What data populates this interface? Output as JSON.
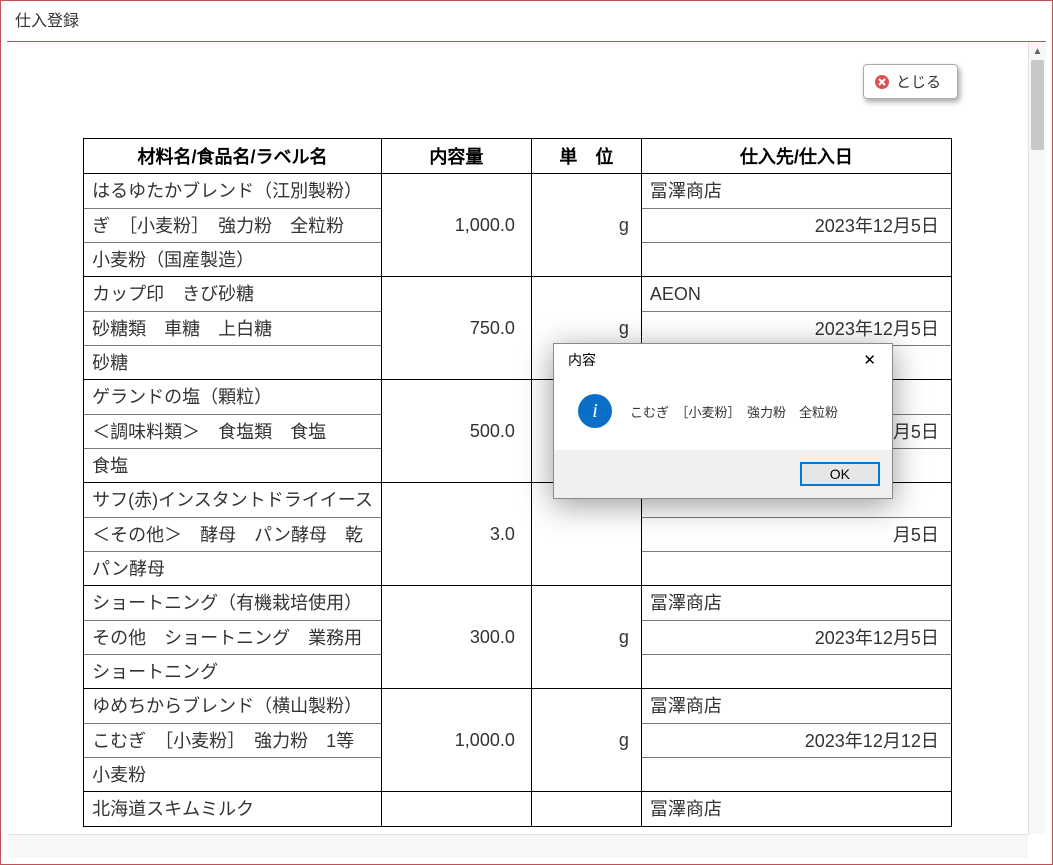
{
  "window_title": "仕入登録",
  "close_button": "とじる",
  "headers": {
    "material": "材料名/食品名/ラベル名",
    "amount": "内容量",
    "unit": "単　位",
    "supplier": "仕入先/仕入日"
  },
  "rows": [
    {
      "m1": "はるゆたかブレンド（江別製粉）",
      "m2": "ぎ　［小麦粉］　強力粉　全粒粉",
      "m3": "小麦粉（国産製造）",
      "amount": "1,000.0",
      "unit": "g",
      "s1": "冨澤商店",
      "s2": "2023年12月5日",
      "s3": ""
    },
    {
      "m1": "カップ印　きび砂糖",
      "m2": "砂糖類　車糖　上白糖",
      "m3": "砂糖",
      "amount": "750.0",
      "unit": "g",
      "s1": "AEON",
      "s2": "2023年12月5日",
      "s3": ""
    },
    {
      "m1": "ゲランドの塩（顆粒）",
      "m2": "＜調味料類＞　食塩類　食塩",
      "m3": "食塩",
      "amount": "500.0",
      "unit": "",
      "s1": "",
      "s2": "月5日",
      "s3": ""
    },
    {
      "m1": "サフ(赤)インスタントドライイース",
      "m2": "＜その他＞　酵母　パン酵母　乾",
      "m3": "パン酵母",
      "amount": "3.0",
      "unit": "",
      "s1": "",
      "s2": "月5日",
      "s3": ""
    },
    {
      "m1": "ショートニング（有機栽培使用）",
      "m2": "その他　ショートニング　業務用",
      "m3": "ショートニング",
      "amount": "300.0",
      "unit": "g",
      "s1": "冨澤商店",
      "s2": "2023年12月5日",
      "s3": ""
    },
    {
      "m1": "ゆめちからブレンド（横山製粉）",
      "m2": "こむぎ　［小麦粉］　強力粉　1等",
      "m3": "小麦粉",
      "amount": "1,000.0",
      "unit": "g",
      "s1": "冨澤商店",
      "s2": "2023年12月12日",
      "s3": ""
    },
    {
      "m1": "北海道スキムミルク",
      "m2": "",
      "m3": "",
      "amount": "",
      "unit": "",
      "s1": "冨澤商店",
      "s2": "",
      "s3": ""
    }
  ],
  "dialog": {
    "title": "内容",
    "message": "こむぎ　［小麦粉］　強力粉　全粒粉",
    "ok": "OK"
  }
}
